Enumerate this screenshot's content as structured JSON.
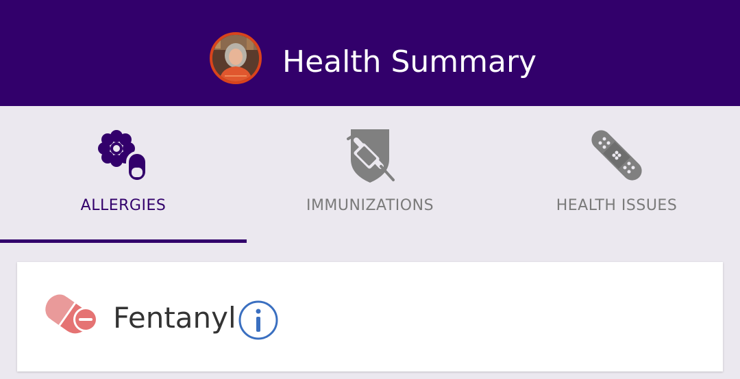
{
  "header": {
    "title": "Health Summary",
    "avatar_alt": "user photo"
  },
  "tabs": [
    {
      "label": "ALLERGIES",
      "icon": "allergy-icon",
      "active": true
    },
    {
      "label": "IMMUNIZATIONS",
      "icon": "syringe-shield-icon",
      "active": false
    },
    {
      "label": "HEALTH ISSUES",
      "icon": "bandage-icon",
      "active": false
    }
  ],
  "allergies": [
    {
      "name": "Fentanyl",
      "icon": "pill-capsule-icon",
      "info_icon": "info-icon"
    }
  ],
  "colors": {
    "header_bg": "#32006b",
    "active_tab": "#32006b",
    "inactive_tab": "#7a7a7a",
    "page_bg": "#ebe8ef",
    "pill_icon": "#e57373",
    "info_icon": "#3a6fc0"
  }
}
